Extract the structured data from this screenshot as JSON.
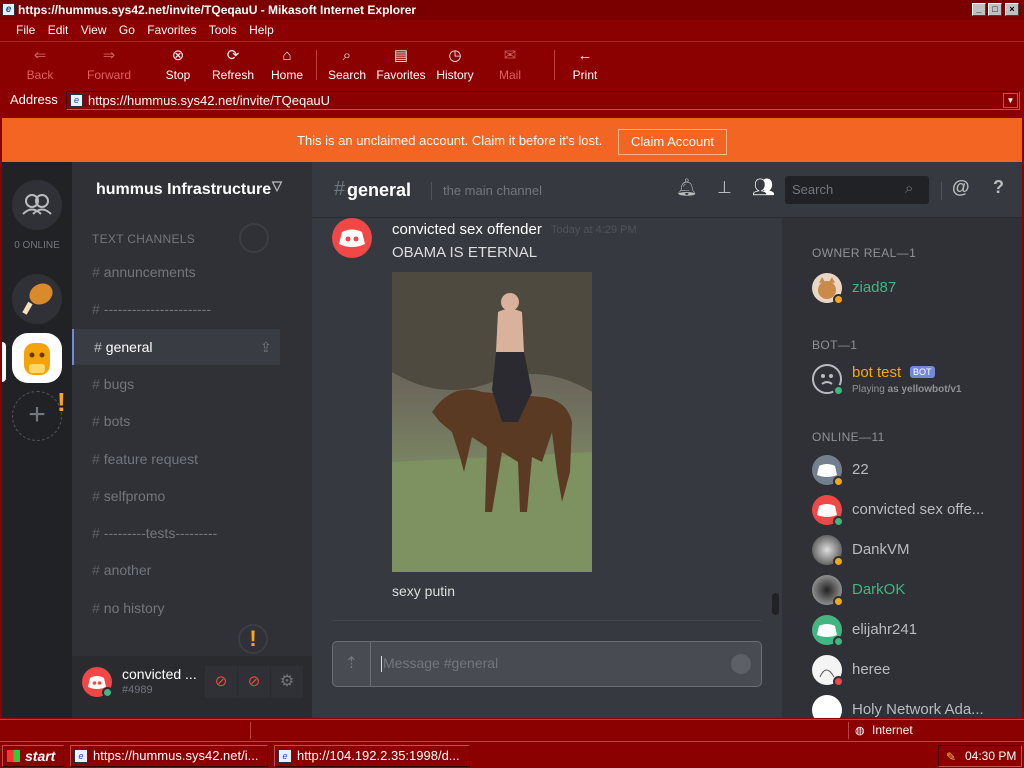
{
  "window": {
    "title": "https://hummus.sys42.net/invite/TQeqauU - Mikasoft Internet Explorer"
  },
  "menu": [
    "File",
    "Edit",
    "View",
    "Go",
    "Favorites",
    "Tools",
    "Help"
  ],
  "toolbar": [
    {
      "label": "Back",
      "icon": "back-arrow-icon",
      "enabled": false
    },
    {
      "label": "Forward",
      "icon": "forward-arrow-icon",
      "enabled": false
    },
    {
      "label": "Stop",
      "icon": "stop-icon",
      "enabled": true
    },
    {
      "label": "Refresh",
      "icon": "refresh-icon",
      "enabled": true
    },
    {
      "label": "Home",
      "icon": "home-icon",
      "enabled": true
    },
    {
      "label": "Search",
      "icon": "search-icon",
      "enabled": true
    },
    {
      "label": "Favorites",
      "icon": "favorites-icon",
      "enabled": true
    },
    {
      "label": "History",
      "icon": "history-icon",
      "enabled": true
    },
    {
      "label": "Mail",
      "icon": "mail-icon",
      "enabled": false
    },
    {
      "label": "Print",
      "icon": "print-icon",
      "enabled": true
    }
  ],
  "address": {
    "label": "Address",
    "url": "https://hummus.sys42.net/invite/TQeqauU"
  },
  "banner": {
    "text": "This is an unclaimed account. Claim it before it's lost.",
    "button": "Claim Account"
  },
  "guilds": {
    "online": "0 ONLINE"
  },
  "server": {
    "name": "hummus Infrastructure",
    "category": "TEXT CHANNELS",
    "channels": [
      "annuncements",
      "-----------------------",
      "general",
      "bugs",
      "bots",
      "feature request",
      "selfpromo",
      "---------tests---------",
      "another",
      "no history"
    ],
    "active_index": 2
  },
  "user": {
    "name": "convicted ...",
    "tag": "#4989"
  },
  "channel": {
    "name": "general",
    "topic": "the main channel",
    "search_placeholder": "Search"
  },
  "message": {
    "author": "convicted sex offender",
    "timestamp": "Today at 4:29 PM",
    "text": "OBAMA IS ETERNAL",
    "caption": "sexy putin"
  },
  "composer": {
    "placeholder": "Message #general"
  },
  "members": {
    "groups": [
      {
        "header": "OWNER REAL—1",
        "members": [
          {
            "name": "ziad87",
            "color": "#43b581",
            "status": "#faa61a",
            "avatar": "cat"
          }
        ]
      },
      {
        "header": "BOT—1",
        "members": [
          {
            "name": "bot test",
            "color": "#faa61a",
            "badge": "BOT",
            "activity_prefix": "Playing ",
            "activity": "as yellowbot/v1",
            "status": "#43b581",
            "avatar": "face"
          }
        ]
      },
      {
        "header": "ONLINE—11",
        "members": [
          {
            "name": "22",
            "color": "#b9bbbe",
            "status": "#faa61a",
            "avatar": "discord-gray"
          },
          {
            "name": "convicted sex offe...",
            "color": "#b9bbbe",
            "status": "#43b581",
            "avatar": "discord-red"
          },
          {
            "name": "DankVM",
            "color": "#b9bbbe",
            "status": "#faa61a",
            "avatar": "photo"
          },
          {
            "name": "DarkOK",
            "color": "#43b581",
            "status": "#faa61a",
            "avatar": "photo2"
          },
          {
            "name": "elijahr241",
            "color": "#b9bbbe",
            "status": "#43b581",
            "avatar": "discord-green"
          },
          {
            "name": "heree",
            "color": "#b9bbbe",
            "status": "#f04747",
            "avatar": "drawing"
          },
          {
            "name": "Holy Network Ada...",
            "color": "#b9bbbe",
            "status": "#43b581",
            "avatar": "white"
          }
        ]
      }
    ]
  },
  "statusbar": {
    "zone": "Internet"
  },
  "taskbar": {
    "start": "start",
    "tasks": [
      "https://hummus.sys42.net/i...",
      "http://104.192.2.35:1998/d..."
    ],
    "clock": "04:30 PM"
  },
  "colors": {
    "chrome": "#8b0000",
    "banner": "#f26522",
    "discord_red": "#f04747",
    "online": "#43b581",
    "idle": "#faa61a"
  }
}
